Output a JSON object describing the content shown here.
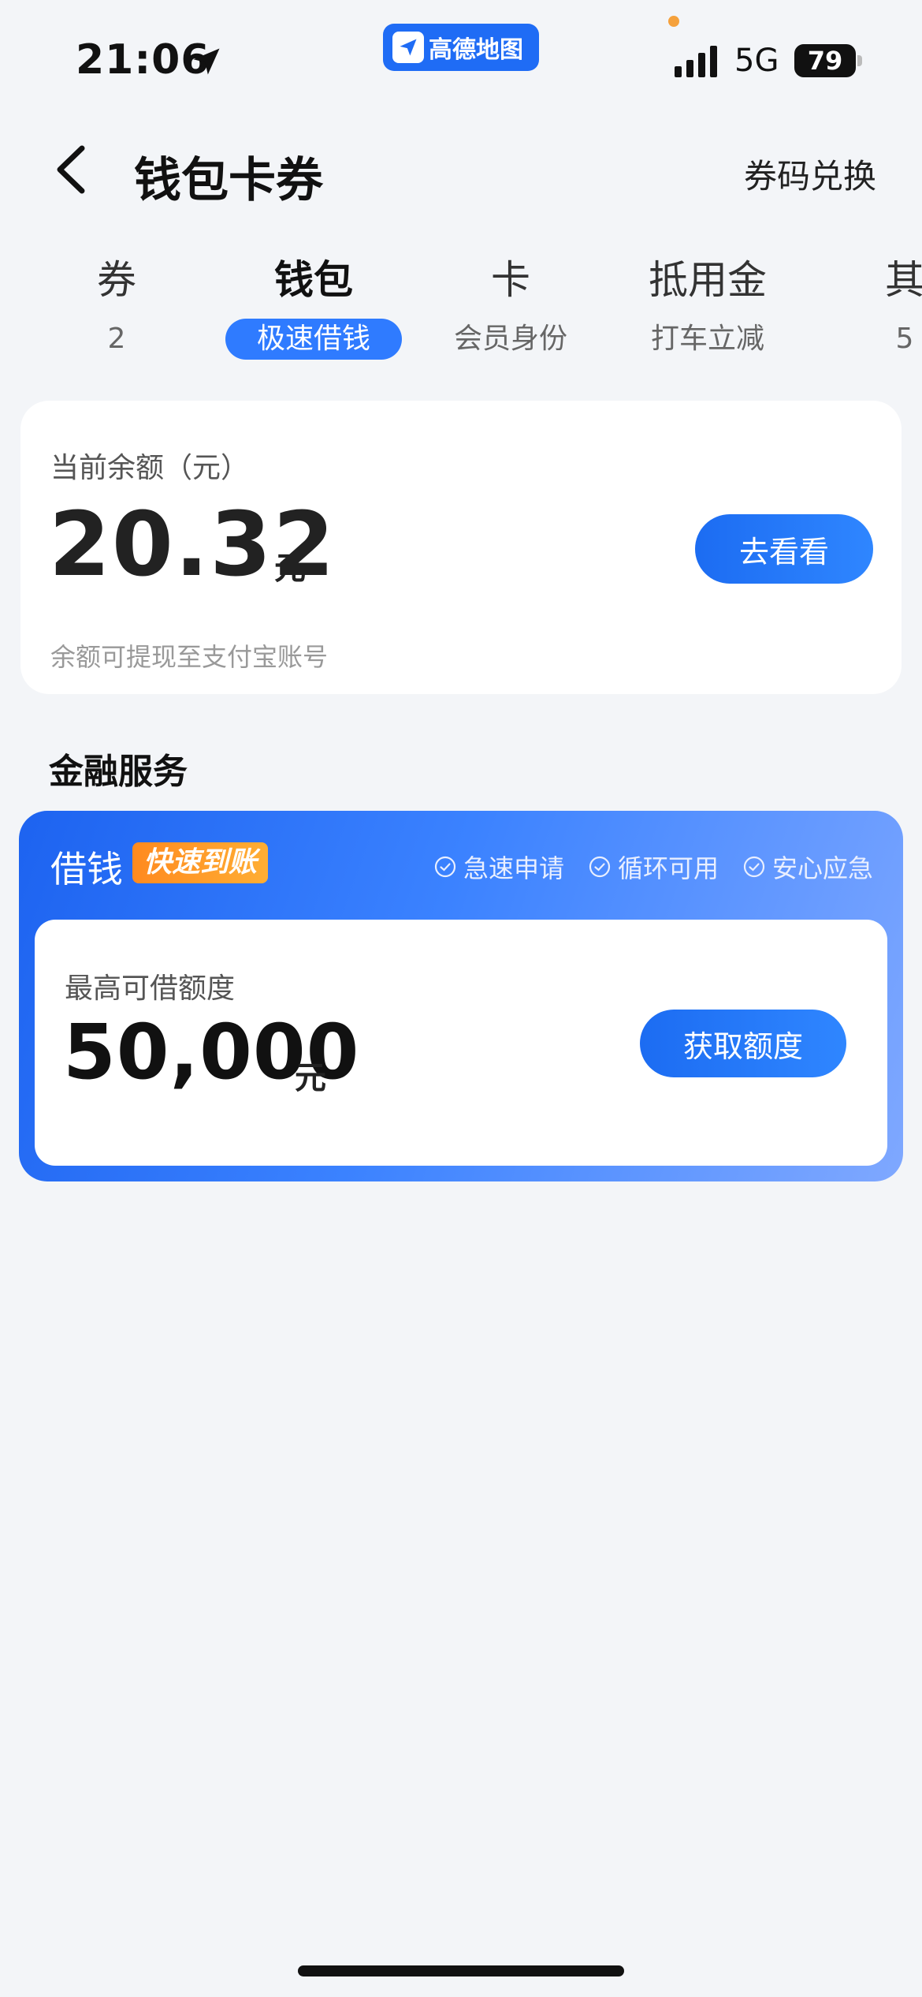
{
  "status_bar": {
    "time": "21:06",
    "app_name": "高德地图",
    "network": "5G",
    "battery": "79",
    "icons": [
      "location-arrow-icon",
      "signal-bars-icon",
      "battery-icon"
    ]
  },
  "header": {
    "title": "钱包卡券",
    "right_link": "券码兑换"
  },
  "tabs": [
    {
      "title": "券",
      "sub": "2"
    },
    {
      "title": "钱包",
      "sub": "极速借钱",
      "active": true
    },
    {
      "title": "卡",
      "sub": "会员身份"
    },
    {
      "title": "抵用金",
      "sub": "打车立减"
    },
    {
      "title": "其",
      "sub": "5"
    }
  ],
  "balance": {
    "label": "当前余额（元）",
    "amount": "20.32",
    "unit": "元",
    "button": "去看看",
    "note": "余额可提现至支付宝账号"
  },
  "finance": {
    "section_title": "金融服务",
    "loan_title": "借钱",
    "badge": "快速到账",
    "features": [
      "急速申请",
      "循环可用",
      "安心应急"
    ],
    "limit_label": "最高可借额度",
    "limit_amount": "50,000",
    "limit_unit": "元",
    "button": "获取额度"
  },
  "colors": {
    "primary": "#1f6cf5",
    "badge": "#ff8a1f",
    "background": "#f3f5f8"
  }
}
